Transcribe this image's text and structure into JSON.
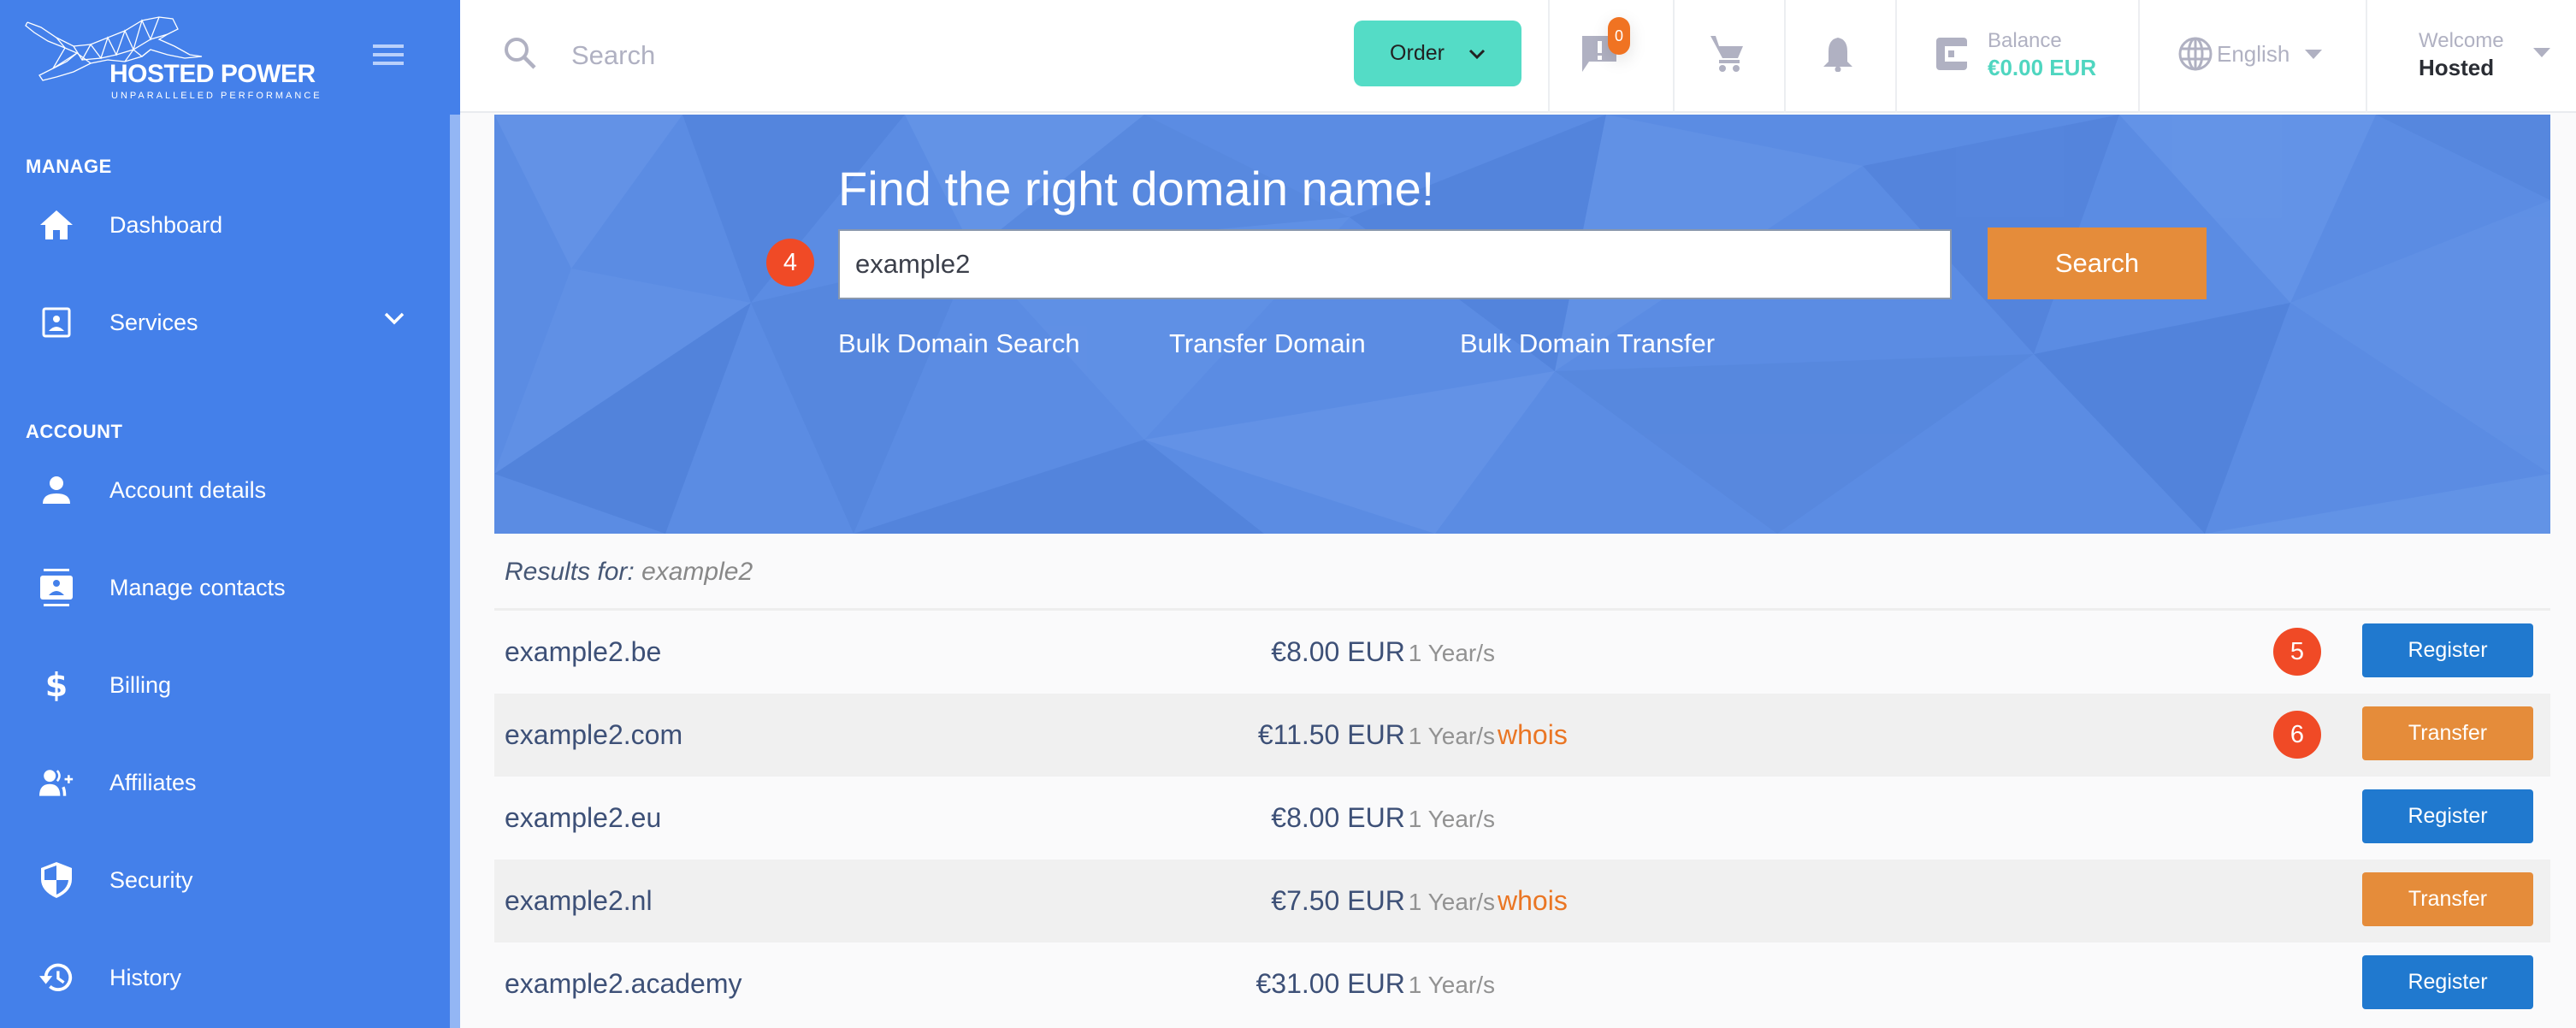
{
  "brand": {
    "name": "HOSTED POWER",
    "tagline": "UNPARALLELED PERFORMANCE"
  },
  "sidebar": {
    "sections": [
      {
        "label": "MANAGE",
        "items": [
          {
            "label": "Dashboard",
            "icon": "home-icon"
          },
          {
            "label": "Services",
            "icon": "services-icon",
            "expandable": true
          }
        ]
      },
      {
        "label": "ACCOUNT",
        "items": [
          {
            "label": "Account details",
            "icon": "person-icon"
          },
          {
            "label": "Manage contacts",
            "icon": "contacts-icon"
          },
          {
            "label": "Billing",
            "icon": "dollar-icon"
          },
          {
            "label": "Affiliates",
            "icon": "add-user-icon"
          },
          {
            "label": "Security",
            "icon": "shield-icon"
          },
          {
            "label": "History",
            "icon": "history-icon"
          }
        ]
      }
    ]
  },
  "header": {
    "search_placeholder": "Search",
    "order_label": "Order",
    "notifications_count": "0",
    "balance_label": "Balance",
    "balance_value": "€0.00 EUR",
    "language": "English",
    "welcome_label": "Welcome",
    "user_name": "Hosted"
  },
  "hero": {
    "title": "Find the right domain name!",
    "input_value": "example2",
    "search_button": "Search",
    "links": [
      "Bulk Domain Search",
      "Transfer Domain",
      "Bulk Domain Transfer"
    ],
    "step_badge": "4"
  },
  "results": {
    "label": "Results for:",
    "query": "example2",
    "rows": [
      {
        "domain": "example2.be",
        "whois": "",
        "price": "€8.00 EUR",
        "period": "1 Year/s",
        "action": "Register",
        "step_badge": "5"
      },
      {
        "domain": "example2.com",
        "whois": "whois",
        "price": "€11.50 EUR",
        "period": "1 Year/s",
        "action": "Transfer",
        "step_badge": "6"
      },
      {
        "domain": "example2.eu",
        "whois": "",
        "price": "€8.00 EUR",
        "period": "1 Year/s",
        "action": "Register",
        "step_badge": ""
      },
      {
        "domain": "example2.nl",
        "whois": "whois",
        "price": "€7.50 EUR",
        "period": "1 Year/s",
        "action": "Transfer",
        "step_badge": ""
      },
      {
        "domain": "example2.academy",
        "whois": "",
        "price": "€31.00 EUR",
        "period": "1 Year/s",
        "action": "Register",
        "step_badge": ""
      }
    ]
  },
  "colors": {
    "sidebar_bg": "#4480ea",
    "order_button": "#54dcc6",
    "register_button": "#2079cf",
    "transfer_button": "#e58c3a",
    "whois_link": "#ea7624",
    "step_badge": "#f04a26",
    "balance_value": "#4fd6c0"
  }
}
